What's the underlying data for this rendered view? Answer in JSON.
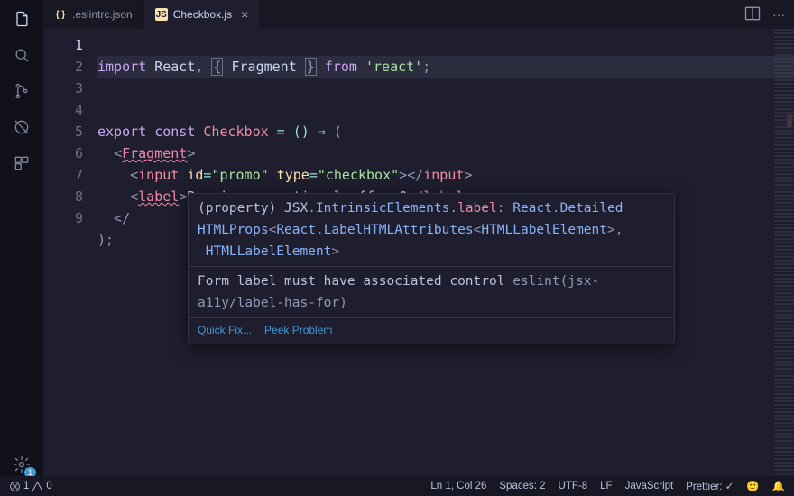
{
  "tabs": [
    {
      "name": ".eslintrc.json",
      "icon": "json",
      "active": false,
      "closable": false
    },
    {
      "name": "Checkbox.js",
      "icon": "js",
      "active": true,
      "closable": true
    }
  ],
  "editor_actions": {
    "split": "▯▯",
    "more": "···"
  },
  "gutter": {
    "lines": 9,
    "current": 1
  },
  "code": {
    "l1": {
      "import": "import",
      "react": "React",
      "comma": ", ",
      "lb": "{",
      "frag": "Fragment",
      "rb": "}",
      "from": "from",
      "str": "'react'",
      "semi": ";"
    },
    "l3": {
      "export": "export",
      "const": "const",
      "name": "Checkbox",
      "eq": " = () ",
      "arrow": "⇒",
      "open": " ("
    },
    "l4": {
      "lt": "<",
      "frag": "Fragment",
      "gt": ">"
    },
    "l5": {
      "lt": "<",
      "input": "input",
      "a_id": "id",
      "e1": "=",
      "v_id": "\"promo\"",
      "a_type": "type",
      "e2": "=",
      "v_type": "\"checkbox\"",
      "gt": ">",
      "clt": "</",
      "cinput": "input",
      "cgt": ">"
    },
    "l6": {
      "lt": "<",
      "label": "label",
      "gt": ">",
      "text": "Receive promotional offers?",
      "clt": "</",
      "clabel": "label",
      "cgt": ">"
    },
    "l7": {
      "close": "</"
    },
    "l8": {
      "end": ");"
    }
  },
  "hover": {
    "sig": {
      "pre": "(property) JSX",
      "dot1": ".",
      "intr": "IntrinsicElements",
      "dot2": ".",
      "label": "label",
      "colon": ": ",
      "react": "React",
      "dot3": ".",
      "det": "Detailed",
      "props": "HTMLProps",
      "lt": "<",
      "react2": "React",
      "dot4": ".",
      "lha": "LabelHTMLAttributes",
      "lt2": "<",
      "hle": "HTMLLabelElement",
      "gt": ">",
      "comma": ",",
      "hle2": "HTMLLabelElement",
      "gt2": ">"
    },
    "lint_msg": "Form label must have associated control ",
    "lint_src": "eslint(jsx-a11y/label-has-for)",
    "quick_fix": "Quick Fix...",
    "peek": "Peek Problem"
  },
  "status": {
    "errors": "1",
    "warnings": "0",
    "ln_col": "Ln 1, Col 26",
    "spaces": "Spaces: 2",
    "encoding": "UTF-8",
    "eol": "LF",
    "lang": "JavaScript",
    "prettier": "Prettier: ✓",
    "feedback": "🙂",
    "bell": "🔔"
  },
  "activity": {
    "gear_badge": "1"
  }
}
